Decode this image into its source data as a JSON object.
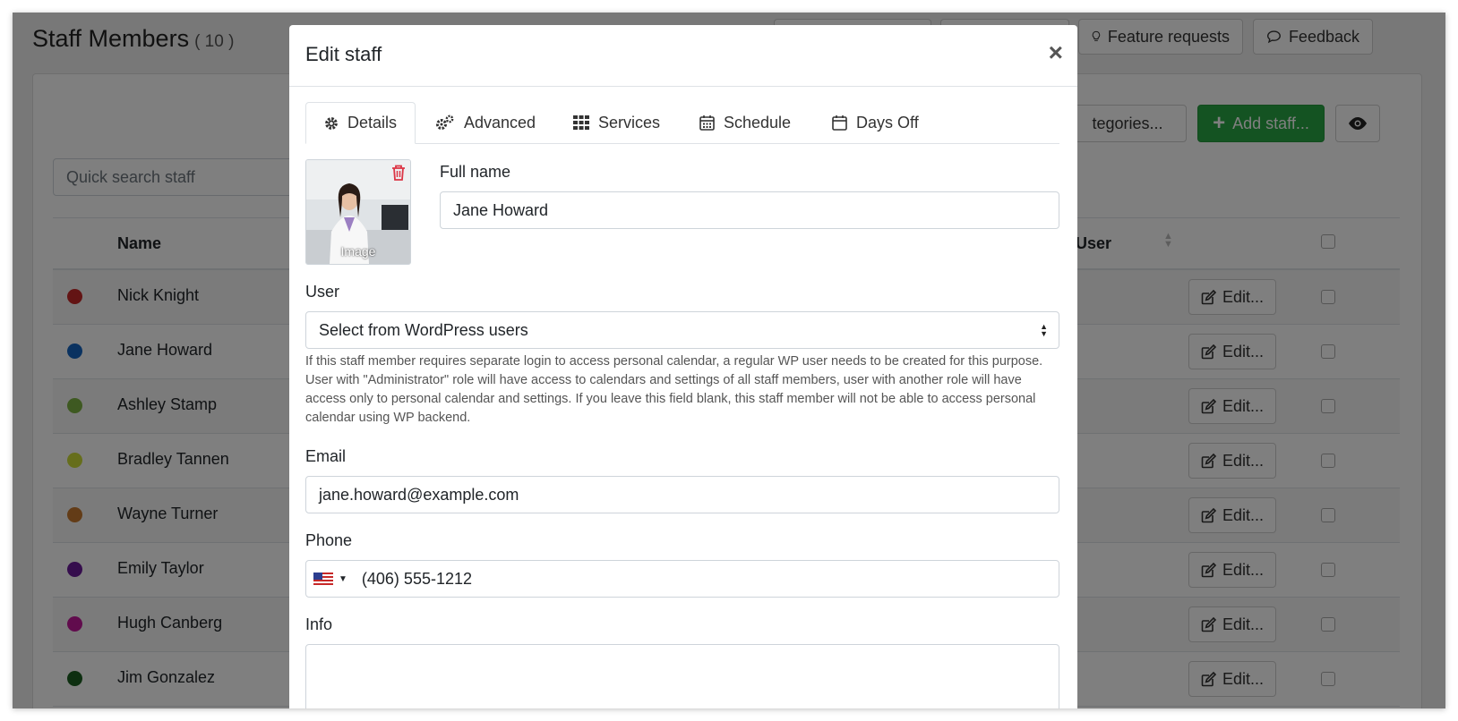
{
  "page": {
    "title": "Staff Members",
    "count": "( 10 )",
    "top_buttons": [
      {
        "label": "Feature requests",
        "icon": "lightbulb-icon"
      },
      {
        "label": "Feedback",
        "icon": "comment-icon"
      }
    ],
    "categories_button": "tegories...",
    "add_staff_button": "Add staff...",
    "search_placeholder": "Quick search staff",
    "columns": {
      "name": "Name",
      "user": "User"
    },
    "edit_label": "Edit...",
    "staff": [
      {
        "name": "Nick Knight",
        "color": "#c62828"
      },
      {
        "name": "Jane Howard",
        "color": "#1565c0"
      },
      {
        "name": "Ashley Stamp",
        "color": "#7cb342"
      },
      {
        "name": "Bradley Tannen",
        "color": "#cddc39"
      },
      {
        "name": "Wayne Turner",
        "color": "#c6792e"
      },
      {
        "name": "Emily Taylor",
        "color": "#6a1b9a"
      },
      {
        "name": "Hugh Canberg",
        "color": "#c2189a"
      },
      {
        "name": "Jim Gonzalez",
        "color": "#1b5e20"
      }
    ]
  },
  "modal": {
    "title": "Edit staff",
    "close_glyph": "×",
    "tabs": [
      {
        "label": "Details",
        "icon": "gear-icon"
      },
      {
        "label": "Advanced",
        "icon": "gears-icon"
      },
      {
        "label": "Services",
        "icon": "grid-icon"
      },
      {
        "label": "Schedule",
        "icon": "calendar-grid-icon"
      },
      {
        "label": "Days Off",
        "icon": "calendar-icon"
      }
    ],
    "image_label": "Image",
    "full_name_label": "Full name",
    "full_name_value": "Jane Howard",
    "user_label": "User",
    "user_select_value": "Select from WordPress users",
    "user_help": "If this staff member requires separate login to access personal calendar, a regular WP user needs to be created for this purpose. User with \"Administrator\" role will have access to calendars and settings of all staff members, user with another role will have access only to personal calendar and settings. If you leave this field blank, this staff member will not be able to access personal calendar using WP backend.",
    "email_label": "Email",
    "email_value": "jane.howard@example.com",
    "phone_label": "Phone",
    "phone_value": "(406) 555-1212",
    "info_label": "Info",
    "colors": {
      "danger": "#dc3545",
      "success": "#28a745"
    }
  }
}
